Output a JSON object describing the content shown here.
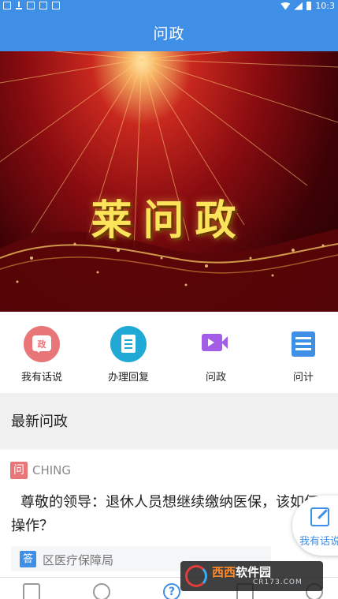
{
  "status_bar": {
    "time": "10:3"
  },
  "header": {
    "title": "问政"
  },
  "banner": {
    "title": "莱问政"
  },
  "quick_actions": [
    {
      "label": "我有话说",
      "icon": "speech-bubble-icon",
      "glyph": "政",
      "color": "#e87578"
    },
    {
      "label": "办理回复",
      "icon": "document-icon",
      "color": "#21a9d6"
    },
    {
      "label": "问政",
      "icon": "video-camera-icon",
      "color": "#a35de6"
    },
    {
      "label": "问计",
      "icon": "form-icon",
      "color": "#3f8fe6"
    }
  ],
  "section": {
    "title": "最新问政"
  },
  "latest": {
    "tag": "问",
    "user": "CHING",
    "question": "尊敬的领导：退休人员想继续缴纳医保，该如何操作？",
    "reply_tag": "答",
    "department": "区医疗保障局"
  },
  "fab": {
    "label": "我有话说",
    "icon": "edit-icon"
  },
  "bottom_nav": [
    {
      "icon": "home-icon"
    },
    {
      "icon": "user-circle-icon"
    },
    {
      "icon": "help-icon",
      "glyph": "?"
    },
    {
      "icon": "list-icon"
    },
    {
      "icon": "profile-icon"
    }
  ],
  "watermark": {
    "brand_a": "西西",
    "brand_b": "软件园",
    "url": "CR173.COM"
  },
  "colors": {
    "primary": "#3f8fe6",
    "red": "#e87578",
    "teal": "#21a9d6",
    "purple": "#a35de6"
  }
}
